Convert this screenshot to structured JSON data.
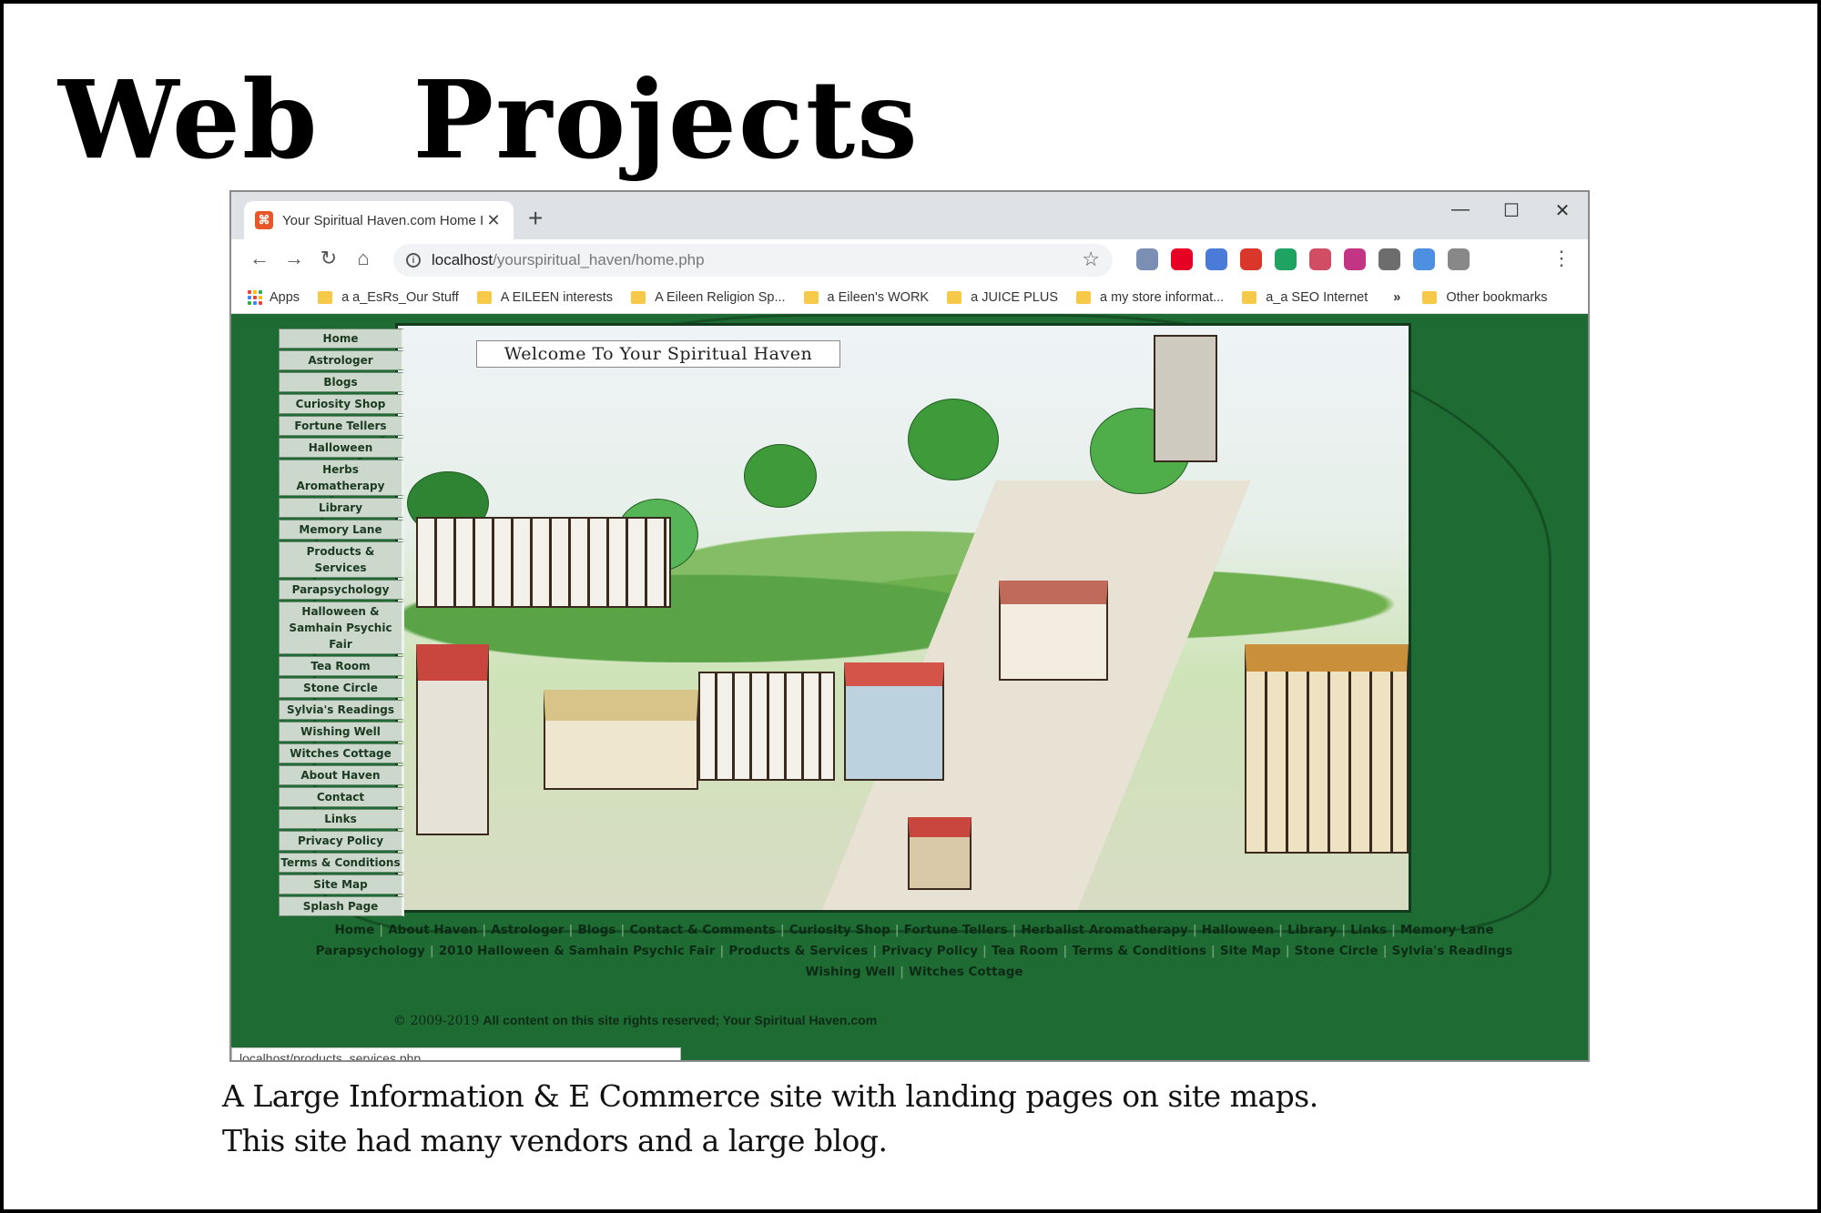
{
  "slide": {
    "title": "Web   Projects",
    "caption_line1": "A Large Information & E Commerce site with landing pages on site maps.",
    "caption_line2": "This site had many vendors and a large blog."
  },
  "browser": {
    "tab_title": "Your Spiritual Haven.com Home I",
    "new_tab": "+",
    "window_controls": {
      "minimize": "—",
      "maximize": "☐",
      "close": "✕"
    },
    "url_host": "localhost",
    "url_path": "/yourspiritual_haven/home.php",
    "bookmarks": [
      {
        "label": "Apps",
        "icon": "apps-icon"
      },
      {
        "label": "a a_EsRs_Our Stuff",
        "icon": "folder-icon"
      },
      {
        "label": "A EILEEN interests",
        "icon": "folder-icon"
      },
      {
        "label": "A Eileen Religion Sp...",
        "icon": "folder-icon"
      },
      {
        "label": "a Eileen's WORK",
        "icon": "folder-icon"
      },
      {
        "label": "a JUICE PLUS",
        "icon": "folder-icon"
      },
      {
        "label": "a my store informat...",
        "icon": "folder-icon"
      },
      {
        "label": "a_a SEO Internet",
        "icon": "folder-icon"
      }
    ],
    "bookmarks_more": "»",
    "other_bookmarks": "Other bookmarks",
    "status_url": "localhost/products_services.php",
    "extension_colors": [
      "#7a8fb3",
      "#e60023",
      "#4a7bd8",
      "#d9372a",
      "#1ea362",
      "#d04d64",
      "#c13584",
      "#6d6d6d",
      "#4d8fe0",
      "#888888"
    ]
  },
  "site": {
    "banner": "Welcome To Your Spiritual Haven",
    "sidenav": [
      "Home",
      "Astrologer",
      "Blogs",
      "Curiosity Shop",
      "Fortune Tellers",
      "Halloween",
      "Herbs Aromatherapy",
      "Library",
      "Memory Lane",
      "Products & Services",
      "Parapsychology",
      "Halloween & Samhain Psychic Fair",
      "Tea Room",
      "Stone Circle",
      "Sylvia's Readings",
      "Wishing Well",
      "Witches Cottage",
      "About Haven",
      "Contact",
      "Links",
      "Privacy Policy",
      "Terms & Conditions",
      "Site Map",
      "Splash Page"
    ],
    "footer_row1": [
      "Home",
      "About Haven",
      "Astrologer",
      "Blogs",
      "Contact & Comments",
      "Curiosity Shop",
      "Fortune Tellers",
      "Herbalist Aromatherapy",
      "Halloween",
      "Library",
      "Links",
      "Memory Lane"
    ],
    "footer_row2": [
      "Parapsychology",
      "2010 Halloween & Samhain Psychic Fair",
      "Products & Services",
      "Privacy Policy",
      "Tea Room",
      "Terms & Conditions",
      "Site Map",
      "Stone Circle",
      "Sylvia's Readings"
    ],
    "footer_row3": [
      "Wishing Well",
      "Witches Cottage"
    ],
    "copyright_symbol": "© 2009-2019",
    "copyright_text": "All content on this site rights reserved; Your Spiritual Haven.com",
    "colors": {
      "background": "#1e6b34",
      "nav_button": "#cdd8cd"
    }
  }
}
